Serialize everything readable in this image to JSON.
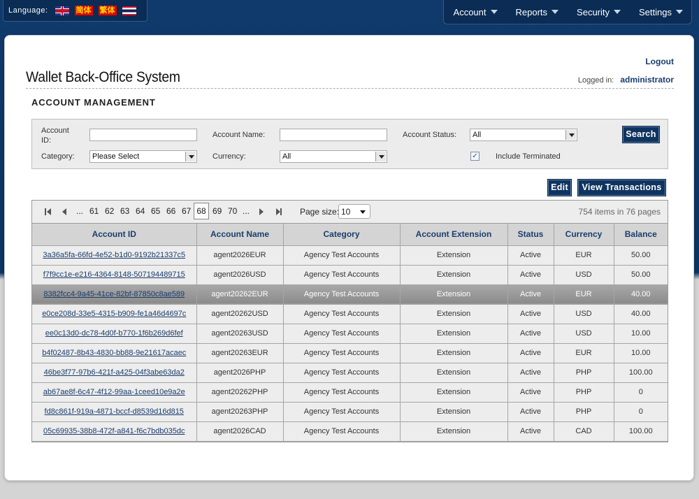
{
  "language_bar": {
    "label": "Language:",
    "flags": [
      "flag-uk-icon",
      "flag-simplified-chinese-icon",
      "flag-traditional-chinese-icon",
      "flag-thailand-icon"
    ],
    "simplified_chinese": "简体",
    "traditional_chinese": "繁体"
  },
  "nav": {
    "items": [
      {
        "label": "Account"
      },
      {
        "label": "Reports"
      },
      {
        "label": "Security"
      },
      {
        "label": "Settings"
      }
    ]
  },
  "header": {
    "logout": "Logout",
    "app_title": "Wallet Back-Office System",
    "logged_in_label": "Logged in:",
    "user": "administrator"
  },
  "section_title": "ACCOUNT MANAGEMENT",
  "filter": {
    "account_id_label_1": "Account",
    "account_id_label_2": "ID:",
    "account_id_value": "",
    "account_name_label": "Account Name:",
    "account_name_value": "",
    "account_status_label": "Account Status:",
    "account_status_value": "All",
    "category_label": "Category:",
    "category_value": "Please Select",
    "currency_label": "Currency:",
    "currency_value": "All",
    "include_terminated_label": "Include Terminated",
    "include_terminated_checked": true,
    "search_button": "Search"
  },
  "actions": {
    "edit": "Edit",
    "view_transactions": "View Transactions"
  },
  "pager": {
    "ellipsis": "...",
    "pages": [
      "61",
      "62",
      "63",
      "64",
      "65",
      "66",
      "67"
    ],
    "current_page": "68",
    "pages_after": [
      "69",
      "70"
    ],
    "page_size_label": "Page size:",
    "page_size_value": "10",
    "total_items": "754",
    "items_in_text": "items in",
    "total_pages": "76",
    "pages_text": "pages"
  },
  "table": {
    "columns": [
      "Account ID",
      "Account Name",
      "Category",
      "Account Extension",
      "Status",
      "Currency",
      "Balance"
    ],
    "rows": [
      {
        "id": "3a36a5fa-66fd-4e52-b1d0-9192b21337c5",
        "name": "agent2026EUR",
        "category": "Agency Test Accounts",
        "extension": "Extension",
        "status": "Active",
        "currency": "EUR",
        "balance": "50.00"
      },
      {
        "id": "f7f9cc1e-e216-4364-8148-507194489715",
        "name": "agent2026USD",
        "category": "Agency Test Accounts",
        "extension": "Extension",
        "status": "Active",
        "currency": "USD",
        "balance": "50.00"
      },
      {
        "id": "8382fcc4-9a45-41ce-82bf-87850c8ae589",
        "name": "agent20262EUR",
        "category": "Agency Test Accounts",
        "extension": "Extension",
        "status": "Active",
        "currency": "EUR",
        "balance": "40.00",
        "selected": true
      },
      {
        "id": "e0ce208d-33e5-4315-b909-fe1a46d4697c",
        "name": "agent20262USD",
        "category": "Agency Test Accounts",
        "extension": "Extension",
        "status": "Active",
        "currency": "USD",
        "balance": "40.00"
      },
      {
        "id": "ee0c13d0-dc78-4d0f-b770-1f6b269d6fef",
        "name": "agent20263USD",
        "category": "Agency Test Accounts",
        "extension": "Extension",
        "status": "Active",
        "currency": "USD",
        "balance": "10.00"
      },
      {
        "id": "b4f02487-8b43-4830-bb88-9e21617acaec",
        "name": "agent20263EUR",
        "category": "Agency Test Accounts",
        "extension": "Extension",
        "status": "Active",
        "currency": "EUR",
        "balance": "10.00"
      },
      {
        "id": "46be3f77-97b6-421f-a425-04f3abe63da2",
        "name": "agent2026PHP",
        "category": "Agency Test Accounts",
        "extension": "Extension",
        "status": "Active",
        "currency": "PHP",
        "balance": "100.00"
      },
      {
        "id": "ab67ae8f-6c47-4f12-99aa-1ceed10e9a2e",
        "name": "agent20262PHP",
        "category": "Agency Test Accounts",
        "extension": "Extension",
        "status": "Active",
        "currency": "PHP",
        "balance": "0"
      },
      {
        "id": "fd8c861f-919a-4871-bccf-d8539d16d815",
        "name": "agent20263PHP",
        "category": "Agency Test Accounts",
        "extension": "Extension",
        "status": "Active",
        "currency": "PHP",
        "balance": "0"
      },
      {
        "id": "05c69935-38b8-472f-a841-f6c7bdb035dc",
        "name": "agent2026CAD",
        "category": "Agency Test Accounts",
        "extension": "Extension",
        "status": "Active",
        "currency": "CAD",
        "balance": "100.00"
      }
    ]
  },
  "colors": {
    "header_bg": "#0b3363",
    "button_bg": "#0f3460",
    "link": "#1a3d6d",
    "selected_row": "#8b8b8b"
  }
}
